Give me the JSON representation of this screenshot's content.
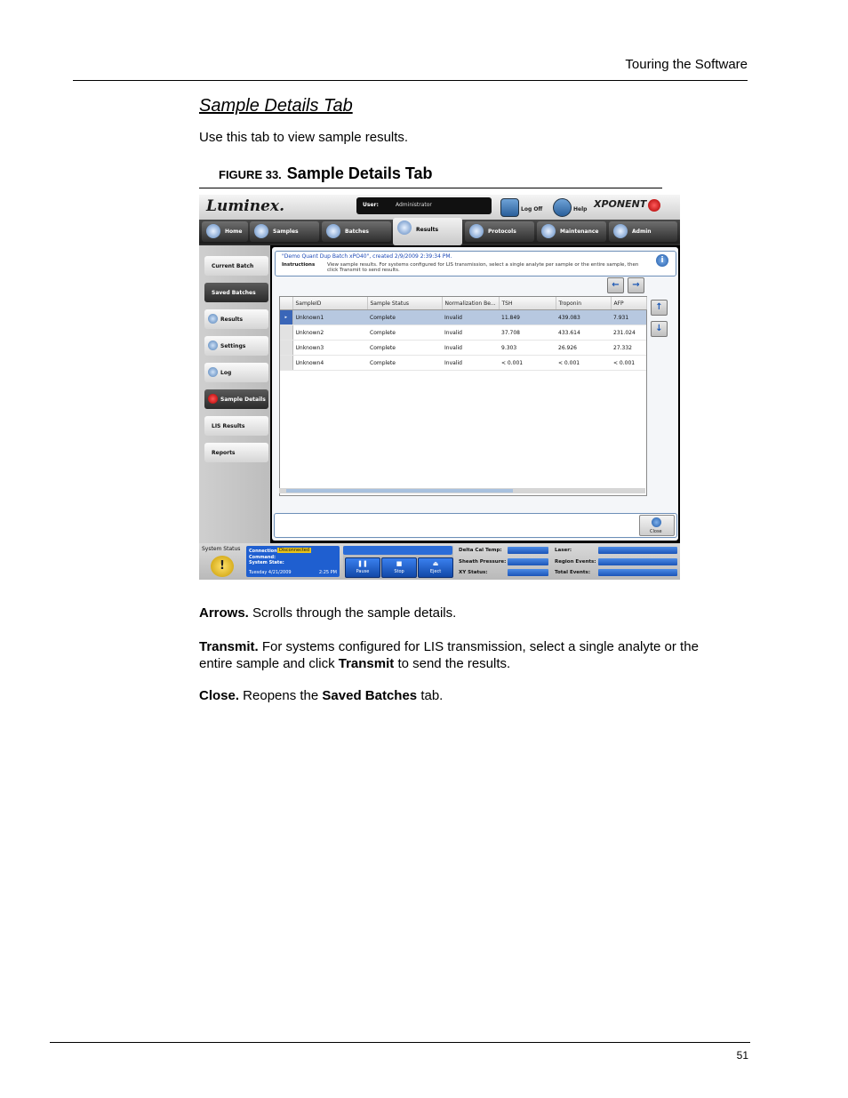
{
  "page": {
    "running_header": "Touring the Software",
    "section_title": "Sample Details Tab",
    "intro": "Use this tab to view sample results.",
    "figure_label": "FIGURE 33.",
    "figure_title": "Sample Details Tab",
    "page_number": "51",
    "descriptions": [
      {
        "term": "Arrows.",
        "text": " Scrolls through the sample details."
      },
      {
        "term": "Transmit.",
        "text": " For systems configured for LIS transmission, select a single analyte or the entire sample and click ",
        "bold2": "Transmit",
        "text2": " to send the results."
      },
      {
        "term": "Close.",
        "text": " Reopens the ",
        "bold2": "Saved Batches",
        "text2": " tab."
      }
    ]
  },
  "screenshot": {
    "logo": "Luminex.",
    "user_label": "User:",
    "user_value": "Administrator",
    "logoff_label": "Log Off",
    "help_label": "Help",
    "brand": "XPONENT",
    "nav_tabs": [
      "Home",
      "Samples",
      "Batches",
      "Results",
      "Protocols",
      "Maintenance",
      "Admin"
    ],
    "active_tab": "Results",
    "side_items": [
      "Current Batch",
      "Saved Batches",
      "Results",
      "Settings",
      "Log",
      "Sample Details",
      "LIS Results",
      "Reports"
    ],
    "batch_title": "\"Demo Quant Dup Batch xPO40\", created 2/9/2009 2:39:34 PM.",
    "instructions_label": "Instructions",
    "instructions_text": "View sample results. For systems configured for LIS transmission, select a single analyte per sample or the entire sample, then click Transmit to send results.",
    "columns": [
      "SampleID",
      "Sample Status",
      "Normalization Be...",
      "TSH",
      "Troponin",
      "AFP"
    ],
    "rows": [
      [
        "Unknown1",
        "Complete",
        "Invalid",
        "11.849",
        "439.083",
        "7.931"
      ],
      [
        "Unknown2",
        "Complete",
        "Invalid",
        "37.708",
        "433.614",
        "231.024"
      ],
      [
        "Unknown3",
        "Complete",
        "Invalid",
        "9.303",
        "26.926",
        "27.332"
      ],
      [
        "Unknown4",
        "Complete",
        "Invalid",
        "< 0.001",
        "< 0.001",
        "< 0.001"
      ]
    ],
    "close_label": "Close",
    "status": {
      "system_status": "System Status",
      "connection_label": "Connection:",
      "connection_value": "Disconnected",
      "command_label": "Command:",
      "system_state_label": "System State:",
      "date": "Tuesday 4/21/2009",
      "time": "2:25 PM",
      "controls": [
        {
          "icon": "❚❚",
          "label": "Pause"
        },
        {
          "icon": "■",
          "label": "Stop"
        },
        {
          "icon": "⏏",
          "label": "Eject"
        }
      ],
      "metrics_left": [
        "Delta Cal Temp:",
        "Sheath Pressure:",
        "XY Status:"
      ],
      "metrics_right": [
        "Laser:",
        "Region Events:",
        "Total Events:"
      ]
    }
  }
}
